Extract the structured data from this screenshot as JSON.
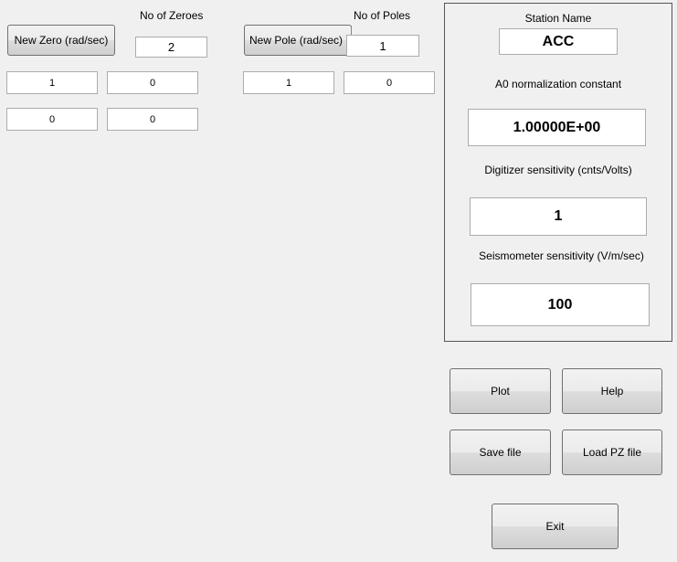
{
  "zeros": {
    "count_label": "No of Zeroes",
    "count_value": "2",
    "new_button": "New Zero  (rad/sec)",
    "rows": [
      {
        "real": "1",
        "imag": "0"
      },
      {
        "real": "0",
        "imag": "0"
      }
    ]
  },
  "poles": {
    "count_label": "No of Poles",
    "count_value": "1",
    "new_button": "New Pole  (rad/sec)",
    "rows": [
      {
        "real": "1",
        "imag": "0"
      }
    ]
  },
  "station": {
    "name_label": "Station Name",
    "name_value": "ACC",
    "a0_label": "A0 normalization constant",
    "a0_value": "1.00000E+00",
    "digitizer_label": "Digitizer sensitivity (cnts/Volts)",
    "digitizer_value": "1",
    "seismometer_label": "Seismometer sensitivity (V/m/sec)",
    "seismometer_value": "100"
  },
  "buttons": {
    "plot": "Plot",
    "help": "Help",
    "save": "Save file",
    "load": "Load PZ file",
    "exit": "Exit"
  }
}
